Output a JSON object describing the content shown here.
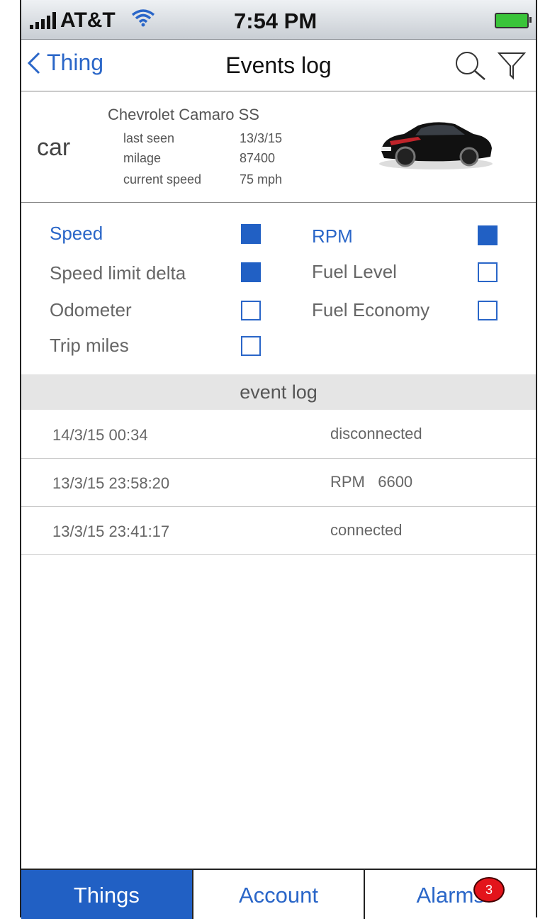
{
  "status": {
    "carrier": "AT&T",
    "time": "7:54 PM"
  },
  "nav": {
    "back_label": "Thing",
    "title": "Events log",
    "icons": [
      "search-icon",
      "filter-icon"
    ]
  },
  "thing": {
    "type_label": "car",
    "name": "Chevrolet Camaro SS",
    "stats": [
      {
        "label": "last seen",
        "value": "13/3/15"
      },
      {
        "label": "milage",
        "value": "87400"
      },
      {
        "label": "current speed",
        "value": "75 mph"
      }
    ]
  },
  "params": [
    {
      "label": "Speed",
      "checked": true
    },
    {
      "label": "RPM",
      "checked": true
    },
    {
      "label": "Speed limit delta",
      "checked": true
    },
    {
      "label": "Fuel Level",
      "checked": false
    },
    {
      "label": "Odometer",
      "checked": false
    },
    {
      "label": "Fuel Economy",
      "checked": false
    },
    {
      "label": "Trip miles",
      "checked": false
    }
  ],
  "log": {
    "header": "event log",
    "rows": [
      {
        "time": "14/3/15 00:34",
        "event": "disconnected"
      },
      {
        "time": "13/3/15 23:58:20",
        "event": "RPM   6600"
      },
      {
        "time": "13/3/15 23:41:17",
        "event": "connected"
      }
    ]
  },
  "tabs": [
    {
      "label": "Things",
      "active": true
    },
    {
      "label": "Account",
      "active": false
    },
    {
      "label": "Alarms",
      "active": false,
      "badge": "3"
    }
  ],
  "colors": {
    "accent": "#2160c4",
    "badge": "#e3141b"
  }
}
